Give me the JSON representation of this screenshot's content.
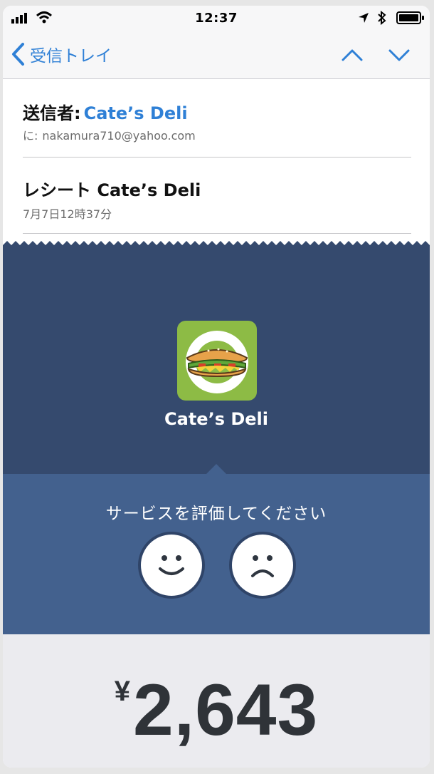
{
  "status_bar": {
    "time": "12:37"
  },
  "nav": {
    "back_label": "受信トレイ"
  },
  "mail": {
    "from_label": "送信者:",
    "from_name": "Cate’s Deli",
    "to_label": "に:",
    "to_address": "nakamura710@yahoo.com",
    "subject": "レシート Cate’s Deli",
    "date": "7月7日12時37分"
  },
  "receipt": {
    "merchant_name": "Cate’s Deli",
    "rating_prompt": "サービスを評価してください",
    "currency_symbol": "¥",
    "amount": "2,643"
  },
  "colors": {
    "accent": "#2f80d6",
    "hero_bg": "#354a6e",
    "rating_bg": "#43618e",
    "logo_bg": "#8dbb45"
  },
  "icons": [
    "signal-icon",
    "wifi-icon",
    "location-icon",
    "bluetooth-icon",
    "battery-icon",
    "chevron-left-icon",
    "chevron-up-icon",
    "chevron-down-icon",
    "happy-face-icon",
    "sad-face-icon",
    "sandwich-logo-icon"
  ]
}
